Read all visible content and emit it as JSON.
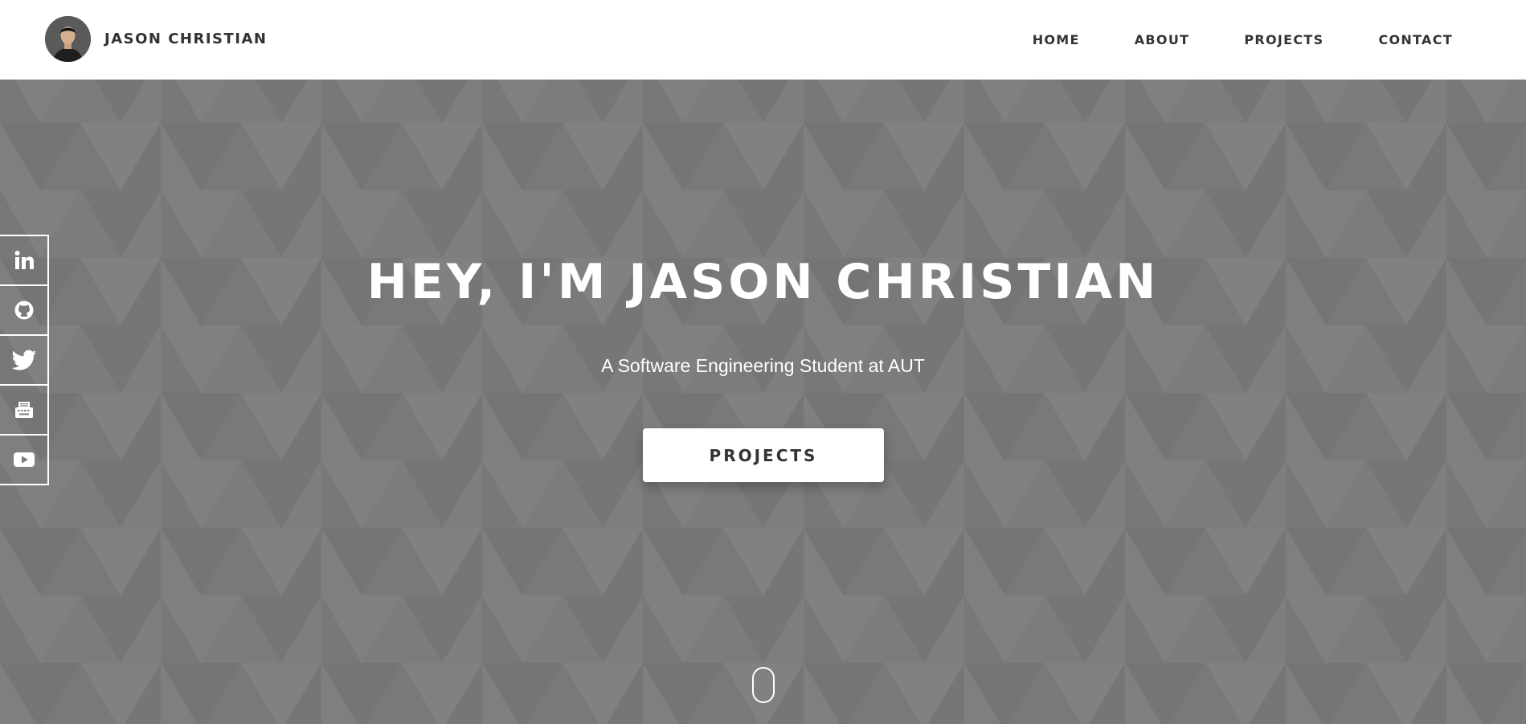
{
  "brand": {
    "name": "JASON CHRISTIAN"
  },
  "nav": {
    "items": [
      {
        "label": "HOME"
      },
      {
        "label": "ABOUT"
      },
      {
        "label": "PROJECTS"
      },
      {
        "label": "CONTACT"
      }
    ]
  },
  "hero": {
    "title": "HEY, I'M JASON CHRISTIAN",
    "subtitle": "A Software Engineering Student at AUT",
    "button_label": "PROJECTS"
  },
  "social": {
    "items": [
      {
        "icon": "linkedin-icon"
      },
      {
        "icon": "github-icon"
      },
      {
        "icon": "twitter-icon"
      },
      {
        "icon": "typewriter-icon"
      },
      {
        "icon": "youtube-icon"
      }
    ]
  },
  "colors": {
    "header_bg": "#ffffff",
    "hero_bg": "#7a7a7a",
    "text_dark": "#333333",
    "text_light": "#ffffff"
  }
}
